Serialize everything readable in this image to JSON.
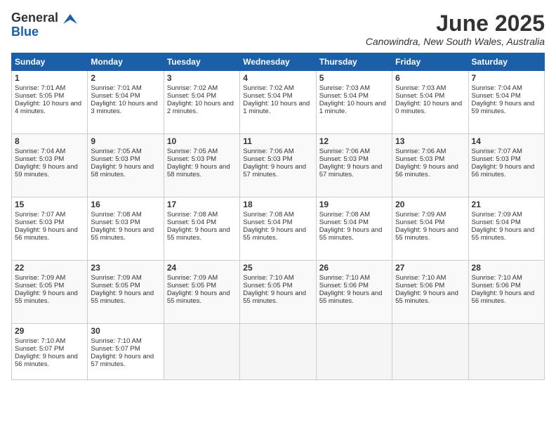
{
  "header": {
    "logo_general": "General",
    "logo_blue": "Blue",
    "month_title": "June 2025",
    "location": "Canowindra, New South Wales, Australia"
  },
  "days_of_week": [
    "Sunday",
    "Monday",
    "Tuesday",
    "Wednesday",
    "Thursday",
    "Friday",
    "Saturday"
  ],
  "weeks": [
    [
      {
        "day": "1",
        "sunrise": "7:01 AM",
        "sunset": "5:05 PM",
        "daylight": "10 hours and 4 minutes."
      },
      {
        "day": "2",
        "sunrise": "7:01 AM",
        "sunset": "5:04 PM",
        "daylight": "10 hours and 3 minutes."
      },
      {
        "day": "3",
        "sunrise": "7:02 AM",
        "sunset": "5:04 PM",
        "daylight": "10 hours and 2 minutes."
      },
      {
        "day": "4",
        "sunrise": "7:02 AM",
        "sunset": "5:04 PM",
        "daylight": "10 hours and 1 minute."
      },
      {
        "day": "5",
        "sunrise": "7:03 AM",
        "sunset": "5:04 PM",
        "daylight": "10 hours and 1 minute."
      },
      {
        "day": "6",
        "sunrise": "7:03 AM",
        "sunset": "5:04 PM",
        "daylight": "10 hours and 0 minutes."
      },
      {
        "day": "7",
        "sunrise": "7:04 AM",
        "sunset": "5:04 PM",
        "daylight": "9 hours and 59 minutes."
      }
    ],
    [
      {
        "day": "8",
        "sunrise": "7:04 AM",
        "sunset": "5:03 PM",
        "daylight": "9 hours and 59 minutes."
      },
      {
        "day": "9",
        "sunrise": "7:05 AM",
        "sunset": "5:03 PM",
        "daylight": "9 hours and 58 minutes."
      },
      {
        "day": "10",
        "sunrise": "7:05 AM",
        "sunset": "5:03 PM",
        "daylight": "9 hours and 58 minutes."
      },
      {
        "day": "11",
        "sunrise": "7:06 AM",
        "sunset": "5:03 PM",
        "daylight": "9 hours and 57 minutes."
      },
      {
        "day": "12",
        "sunrise": "7:06 AM",
        "sunset": "5:03 PM",
        "daylight": "9 hours and 57 minutes."
      },
      {
        "day": "13",
        "sunrise": "7:06 AM",
        "sunset": "5:03 PM",
        "daylight": "9 hours and 56 minutes."
      },
      {
        "day": "14",
        "sunrise": "7:07 AM",
        "sunset": "5:03 PM",
        "daylight": "9 hours and 56 minutes."
      }
    ],
    [
      {
        "day": "15",
        "sunrise": "7:07 AM",
        "sunset": "5:03 PM",
        "daylight": "9 hours and 56 minutes."
      },
      {
        "day": "16",
        "sunrise": "7:08 AM",
        "sunset": "5:03 PM",
        "daylight": "9 hours and 55 minutes."
      },
      {
        "day": "17",
        "sunrise": "7:08 AM",
        "sunset": "5:04 PM",
        "daylight": "9 hours and 55 minutes."
      },
      {
        "day": "18",
        "sunrise": "7:08 AM",
        "sunset": "5:04 PM",
        "daylight": "9 hours and 55 minutes."
      },
      {
        "day": "19",
        "sunrise": "7:08 AM",
        "sunset": "5:04 PM",
        "daylight": "9 hours and 55 minutes."
      },
      {
        "day": "20",
        "sunrise": "7:09 AM",
        "sunset": "5:04 PM",
        "daylight": "9 hours and 55 minutes."
      },
      {
        "day": "21",
        "sunrise": "7:09 AM",
        "sunset": "5:04 PM",
        "daylight": "9 hours and 55 minutes."
      }
    ],
    [
      {
        "day": "22",
        "sunrise": "7:09 AM",
        "sunset": "5:05 PM",
        "daylight": "9 hours and 55 minutes."
      },
      {
        "day": "23",
        "sunrise": "7:09 AM",
        "sunset": "5:05 PM",
        "daylight": "9 hours and 55 minutes."
      },
      {
        "day": "24",
        "sunrise": "7:09 AM",
        "sunset": "5:05 PM",
        "daylight": "9 hours and 55 minutes."
      },
      {
        "day": "25",
        "sunrise": "7:10 AM",
        "sunset": "5:05 PM",
        "daylight": "9 hours and 55 minutes."
      },
      {
        "day": "26",
        "sunrise": "7:10 AM",
        "sunset": "5:06 PM",
        "daylight": "9 hours and 55 minutes."
      },
      {
        "day": "27",
        "sunrise": "7:10 AM",
        "sunset": "5:06 PM",
        "daylight": "9 hours and 55 minutes."
      },
      {
        "day": "28",
        "sunrise": "7:10 AM",
        "sunset": "5:06 PM",
        "daylight": "9 hours and 56 minutes."
      }
    ],
    [
      {
        "day": "29",
        "sunrise": "7:10 AM",
        "sunset": "5:07 PM",
        "daylight": "9 hours and 56 minutes."
      },
      {
        "day": "30",
        "sunrise": "7:10 AM",
        "sunset": "5:07 PM",
        "daylight": "9 hours and 57 minutes."
      },
      null,
      null,
      null,
      null,
      null
    ]
  ]
}
